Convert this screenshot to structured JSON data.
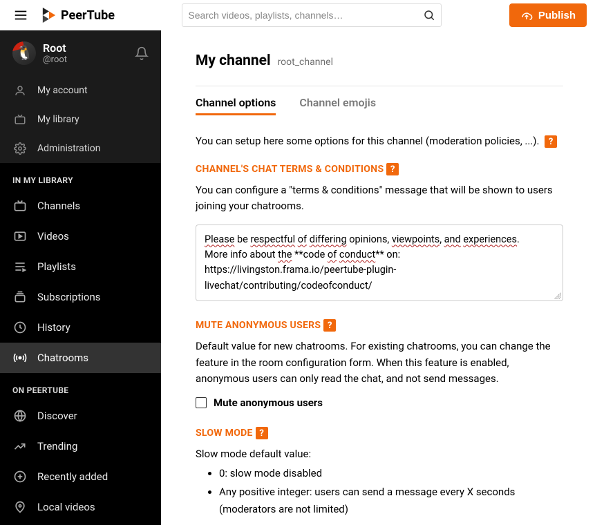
{
  "brand": {
    "name": "PeerTube"
  },
  "search": {
    "placeholder": "Search videos, playlists, channels…"
  },
  "publish": {
    "label": "Publish"
  },
  "user": {
    "displayName": "Root",
    "handle": "@root"
  },
  "sidebar": {
    "account": [
      {
        "label": "My account"
      },
      {
        "label": "My library"
      },
      {
        "label": "Administration"
      }
    ],
    "librarySection": "IN MY LIBRARY",
    "library": [
      {
        "label": "Channels"
      },
      {
        "label": "Videos"
      },
      {
        "label": "Playlists"
      },
      {
        "label": "Subscriptions"
      },
      {
        "label": "History"
      },
      {
        "label": "Chatrooms"
      }
    ],
    "onSection": "ON PEERTUBE",
    "on": [
      {
        "label": "Discover"
      },
      {
        "label": "Trending"
      },
      {
        "label": "Recently added"
      },
      {
        "label": "Local videos"
      }
    ]
  },
  "page": {
    "title": "My channel",
    "channelId": "root_channel",
    "tabs": [
      {
        "label": "Channel options"
      },
      {
        "label": "Channel emojis"
      }
    ],
    "intro": "You can setup here some options for this channel (moderation policies, ...).",
    "termsHead": "CHANNEL'S CHAT TERMS & CONDITIONS",
    "termsDesc": "You can configure a \"terms & conditions\" message that will be shown to users joining your chatrooms.",
    "termsValueFull": "Please be respectful of differing opinions, viewpoints, and experiences.\nMore info about the **code of conduct** on:\nhttps://livingston.frama.io/peertube-plugin-livechat/contributing/codeofconduct/",
    "termsParts": {
      "t0": "Please",
      "t1": " be ",
      "t2": "respectful",
      "t3": " ",
      "t4": "of",
      "t5": " ",
      "t6": "differing",
      "t7": " opinions, ",
      "t8": "viewpoints",
      "t9": ", ",
      "t10": "and",
      "t11": " ",
      "t12": "experiences",
      "t13": ".",
      "l2a": "More info about ",
      "l2b": "the",
      "l2c": " **code ",
      "l2d": "of",
      "l2e": " ",
      "l2f": "conduct",
      "l2g": "** on:",
      "l3": "https://livingston.frama.io/peertube-plugin-livechat/contributing/codeofconduct/"
    },
    "muteHead": "MUTE ANONYMOUS USERS",
    "muteDesc": "Default value for new chatrooms. For existing chatrooms, you can change the feature in the room configuration form. When this feature is enabled, anonymous users can only read the chat, and not send messages.",
    "muteCheckLabel": "Mute anonymous users",
    "slowHead": "SLOW MODE",
    "slowIntro": "Slow mode default value:",
    "slowItems": [
      "0: slow mode disabled",
      "Any positive integer: users can send a message every X seconds (moderators are not limited)"
    ],
    "helpGlyph": "?"
  },
  "colors": {
    "accent": "#f1680c"
  }
}
